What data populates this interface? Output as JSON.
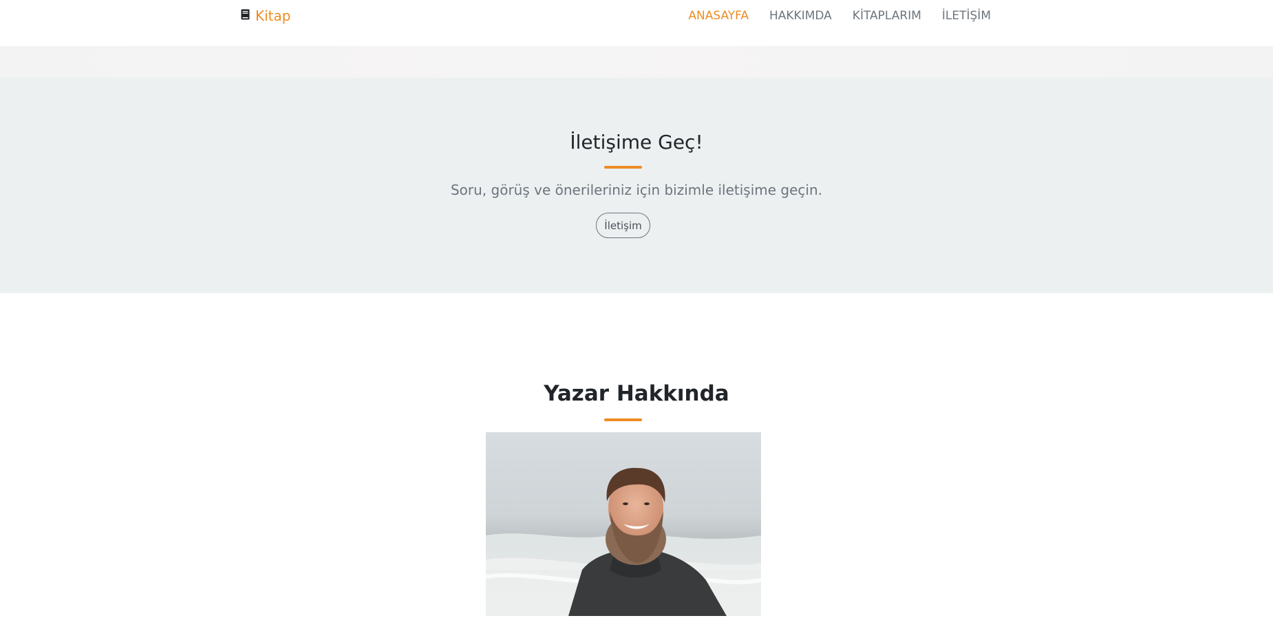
{
  "navbar": {
    "brand_icon": "book-icon",
    "brand_text": "Kitap",
    "links": [
      {
        "label": "ANASAYFA",
        "active": true
      },
      {
        "label": "HAKKIMDA",
        "active": false
      },
      {
        "label": "KİTAPLARIM",
        "active": false
      },
      {
        "label": "İLETİŞİM",
        "active": false
      }
    ]
  },
  "contact": {
    "title": "İletişime Geç!",
    "text": "Soru, görüş ve önerileriniz için bizimle iletişime geçin.",
    "button_label": "İletişim"
  },
  "about": {
    "title": "Yazar Hakkında",
    "photo_subject": "smiling bearded man in dark sweater by the sea"
  },
  "colors": {
    "accent": "#ee8c22",
    "muted_text": "#6c757d",
    "section_bg": "#ecf0f1"
  }
}
